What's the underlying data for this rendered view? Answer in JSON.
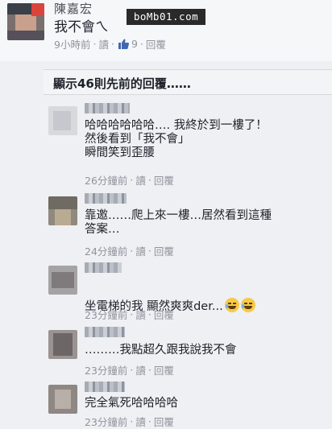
{
  "header": {
    "name": "陳嘉宏",
    "text": "我不會ㄟ",
    "meta": {
      "time": "9小時前",
      "reply_label": "讀",
      "like_count": "9",
      "reply_action": "回覆"
    }
  },
  "watermark": "boMb01.com",
  "prev_comments": {
    "label": "顯示46則先前的回覆……"
  },
  "comments": [
    {
      "text": "哈哈哈哈哈哈…. 我終於到一樓了！\n然後看到「我不會」\n瞬間笑到歪腰",
      "time": "26分鐘前",
      "read": "讀",
      "reply": "回覆"
    },
    {
      "text": "靠邀……爬上來一樓…居然看到這種\n答案…",
      "time": "24分鐘前",
      "read": "讀",
      "reply": "回覆"
    },
    {
      "text": "坐電梯的我  顯然爽爽der...",
      "time": "23分鐘前",
      "read": "讀",
      "reply": "回覆"
    },
    {
      "text": "………我點超久跟我說我不會",
      "time": "23分鐘前",
      "read": "讀",
      "reply": "回覆"
    },
    {
      "text": "完全氣死哈哈哈哈",
      "time": "23分鐘前",
      "read": "讀",
      "reply": "回覆"
    }
  ],
  "icons": {
    "like": "thumbs-up-icon",
    "laugh": "laughing-emoji-icon"
  },
  "colors": {
    "meta_gray": "#90949c",
    "like_blue": "#4267b2",
    "text": "#1d2129"
  }
}
